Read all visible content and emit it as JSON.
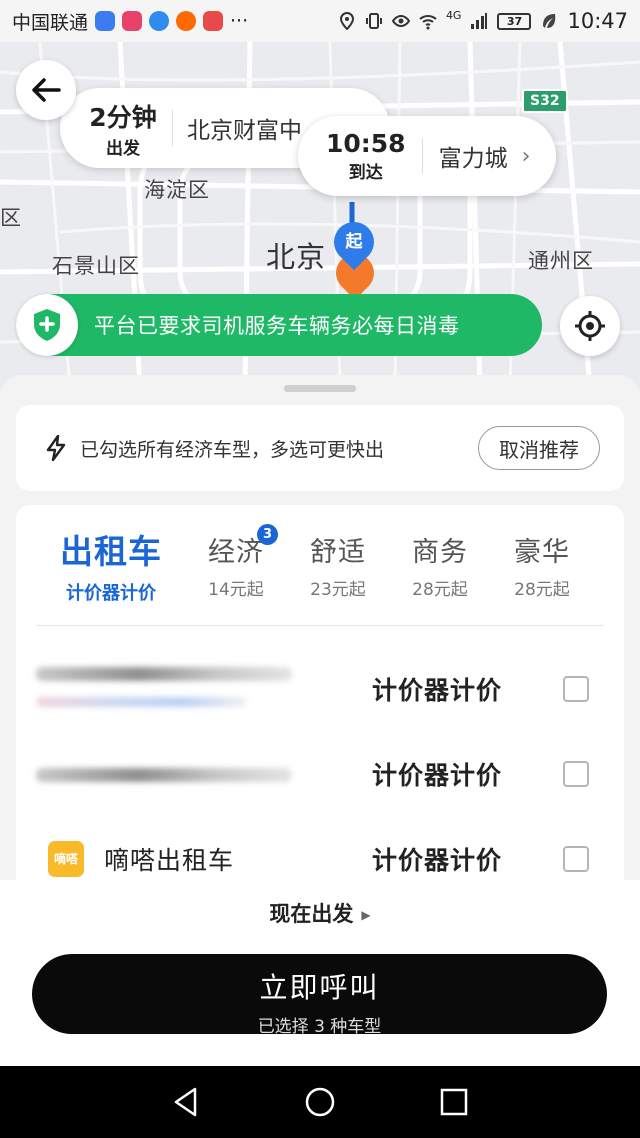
{
  "status_bar": {
    "carrier": "中国联通",
    "battery": "37",
    "network": "4G",
    "time": "10:47",
    "app_icon_colors": [
      "#3d7cf0",
      "#e8416c",
      "#2f8bf0",
      "#ff6a00",
      "#e84a4a"
    ]
  },
  "map": {
    "labels": {
      "haidian": "海淀区",
      "shijingshan": "石景山区",
      "beijing": "北京",
      "tongzhou": "通州区",
      "xicheng": "区",
      "highway": "S32"
    },
    "departure": {
      "eta_value": "2分钟",
      "eta_label": "出发",
      "place": "北京财富中"
    },
    "arrival": {
      "time": "10:58",
      "label": "到达",
      "place": "富力城"
    },
    "start_pin": "起",
    "safety_banner": "平台已要求司机服务车辆务必每日消毒"
  },
  "sheet": {
    "notice": "已勾选所有经济车型，多选可更快出",
    "cancel_recommend": "取消推荐",
    "tabs": [
      {
        "name": "出租车",
        "sub": "计价器计价",
        "active": true
      },
      {
        "name": "经济",
        "sub": "14元起",
        "badge": "3"
      },
      {
        "name": "舒适",
        "sub": "23元起"
      },
      {
        "name": "商务",
        "sub": "28元起"
      },
      {
        "name": "豪华",
        "sub": "28元起"
      }
    ],
    "options": [
      {
        "name": "",
        "price": "计价器计价",
        "checked": false
      },
      {
        "name": "",
        "price": "计价器计价",
        "checked": false
      },
      {
        "name": "嘀嗒出租车",
        "logo": "嘀嗒",
        "price": "计价器计价",
        "checked": false
      }
    ]
  },
  "footer": {
    "depart_now": "现在出发",
    "call_button": "立即呼叫",
    "call_sub": "已选择 3 种车型"
  },
  "colors": {
    "accent_blue": "#1a66d6",
    "banner_green": "#1fb866",
    "start_pin": "#2e7bea",
    "end_pin": "#f37a2a",
    "brand_yellow": "#f8b92b"
  }
}
